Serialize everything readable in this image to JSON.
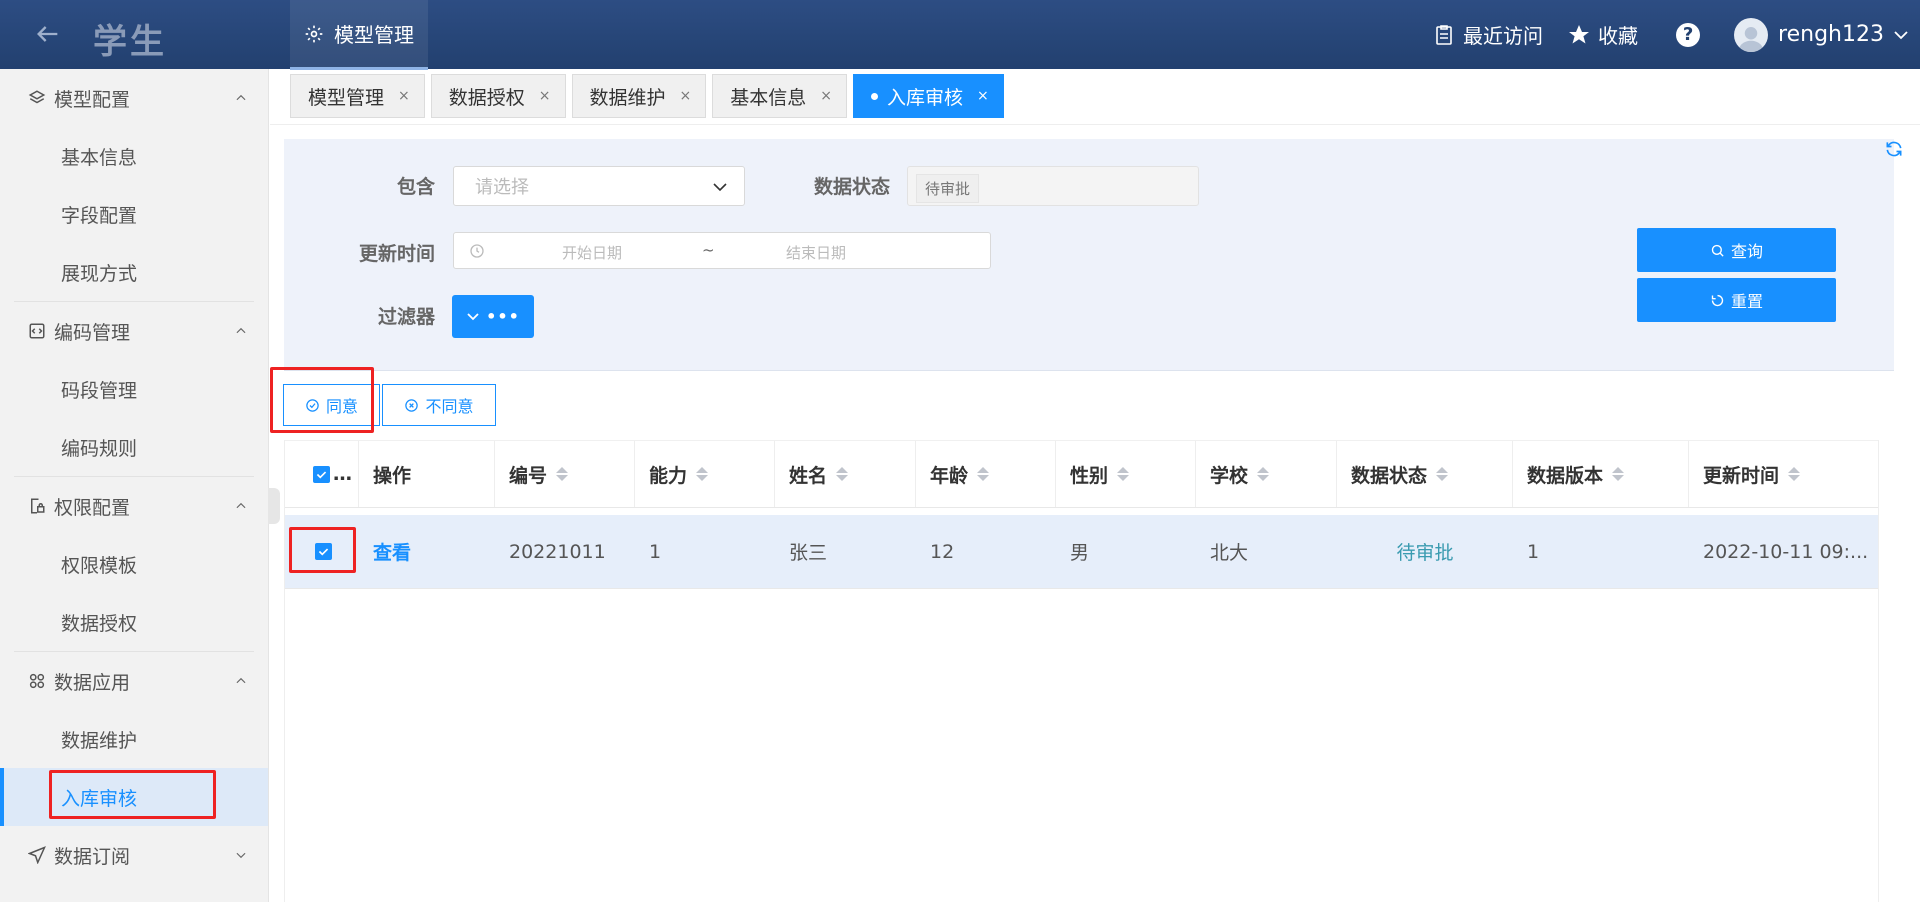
{
  "header": {
    "app_title": "学生",
    "top_nav_label": "模型管理",
    "recent_label": "最近访问",
    "favorites_label": "收藏",
    "help_symbol": "?",
    "username": "rengh123"
  },
  "sidebar": {
    "groups": [
      {
        "label": "模型配置",
        "items": [
          "基本信息",
          "字段配置",
          "展现方式"
        ]
      },
      {
        "label": "编码管理",
        "items": [
          "码段管理",
          "编码规则"
        ]
      },
      {
        "label": "权限配置",
        "items": [
          "权限模板",
          "数据授权"
        ]
      },
      {
        "label": "数据应用",
        "items": [
          "数据维护",
          "入库审核"
        ]
      },
      {
        "label": "数据订阅",
        "items": []
      }
    ],
    "active_item": "入库审核"
  },
  "tabs": [
    {
      "label": "模型管理",
      "close": "×"
    },
    {
      "label": "数据授权",
      "close": "×"
    },
    {
      "label": "数据维护",
      "close": "×"
    },
    {
      "label": "基本信息",
      "close": "×"
    },
    {
      "label": "入库审核",
      "close": "×",
      "active": true
    }
  ],
  "filters": {
    "contains_label": "包含",
    "contains_placeholder": "请选择",
    "status_label": "数据状态",
    "status_value": "待审批",
    "update_time_label": "更新时间",
    "start_placeholder": "开始日期",
    "range_separator": "~",
    "end_placeholder": "结束日期",
    "filter_label": "过滤器",
    "filter_button_text": "•••",
    "query_button": "查询",
    "reset_button": "重置"
  },
  "actions": {
    "approve": "同意",
    "reject": "不同意"
  },
  "table": {
    "select_all_suffix": "…",
    "columns": [
      "操作",
      "编号",
      "能力",
      "姓名",
      "年龄",
      "性别",
      "学校",
      "数据状态",
      "数据版本",
      "更新时间"
    ],
    "rows": [
      {
        "action": "查看",
        "id": "20221011",
        "ability": "1",
        "name": "张三",
        "age": "12",
        "gender": "男",
        "school": "北大",
        "status": "待审批",
        "version": "1",
        "updated": "2022-10-11 09:..."
      }
    ]
  },
  "colors": {
    "header_bg": "#22406f",
    "accent": "#1890ff",
    "highlight": "#ee2222"
  }
}
